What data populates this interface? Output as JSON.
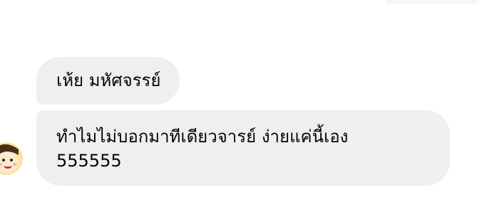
{
  "messages": [
    {
      "text": "เห้ย มหัศจรรย์"
    },
    {
      "lines": [
        "ทำไมไม่บอกมาทีเดียวจารย์ ง่ายแค่นี้เอง",
        "555555"
      ]
    }
  ],
  "colors": {
    "bubble_bg": "#efefef",
    "text": "#050505",
    "page_bg": "#ffffff"
  },
  "icons": {
    "avatar": "cartoon-face-avatar-icon"
  }
}
